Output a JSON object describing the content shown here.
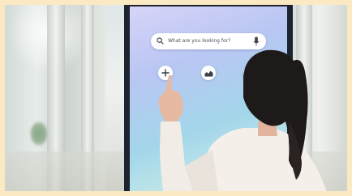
{
  "kiosk": {
    "search": {
      "placeholder": "What are you looking for?"
    },
    "buttons": [
      {
        "icon": "plus-icon"
      },
      {
        "icon": "chart-icon"
      },
      {
        "icon": "partial-icon"
      }
    ]
  },
  "colors": {
    "screen_start": "#d7d4f8",
    "screen_mid": "#a3d6ea",
    "frame": "#1d2430",
    "border": "#fbe9c4"
  }
}
